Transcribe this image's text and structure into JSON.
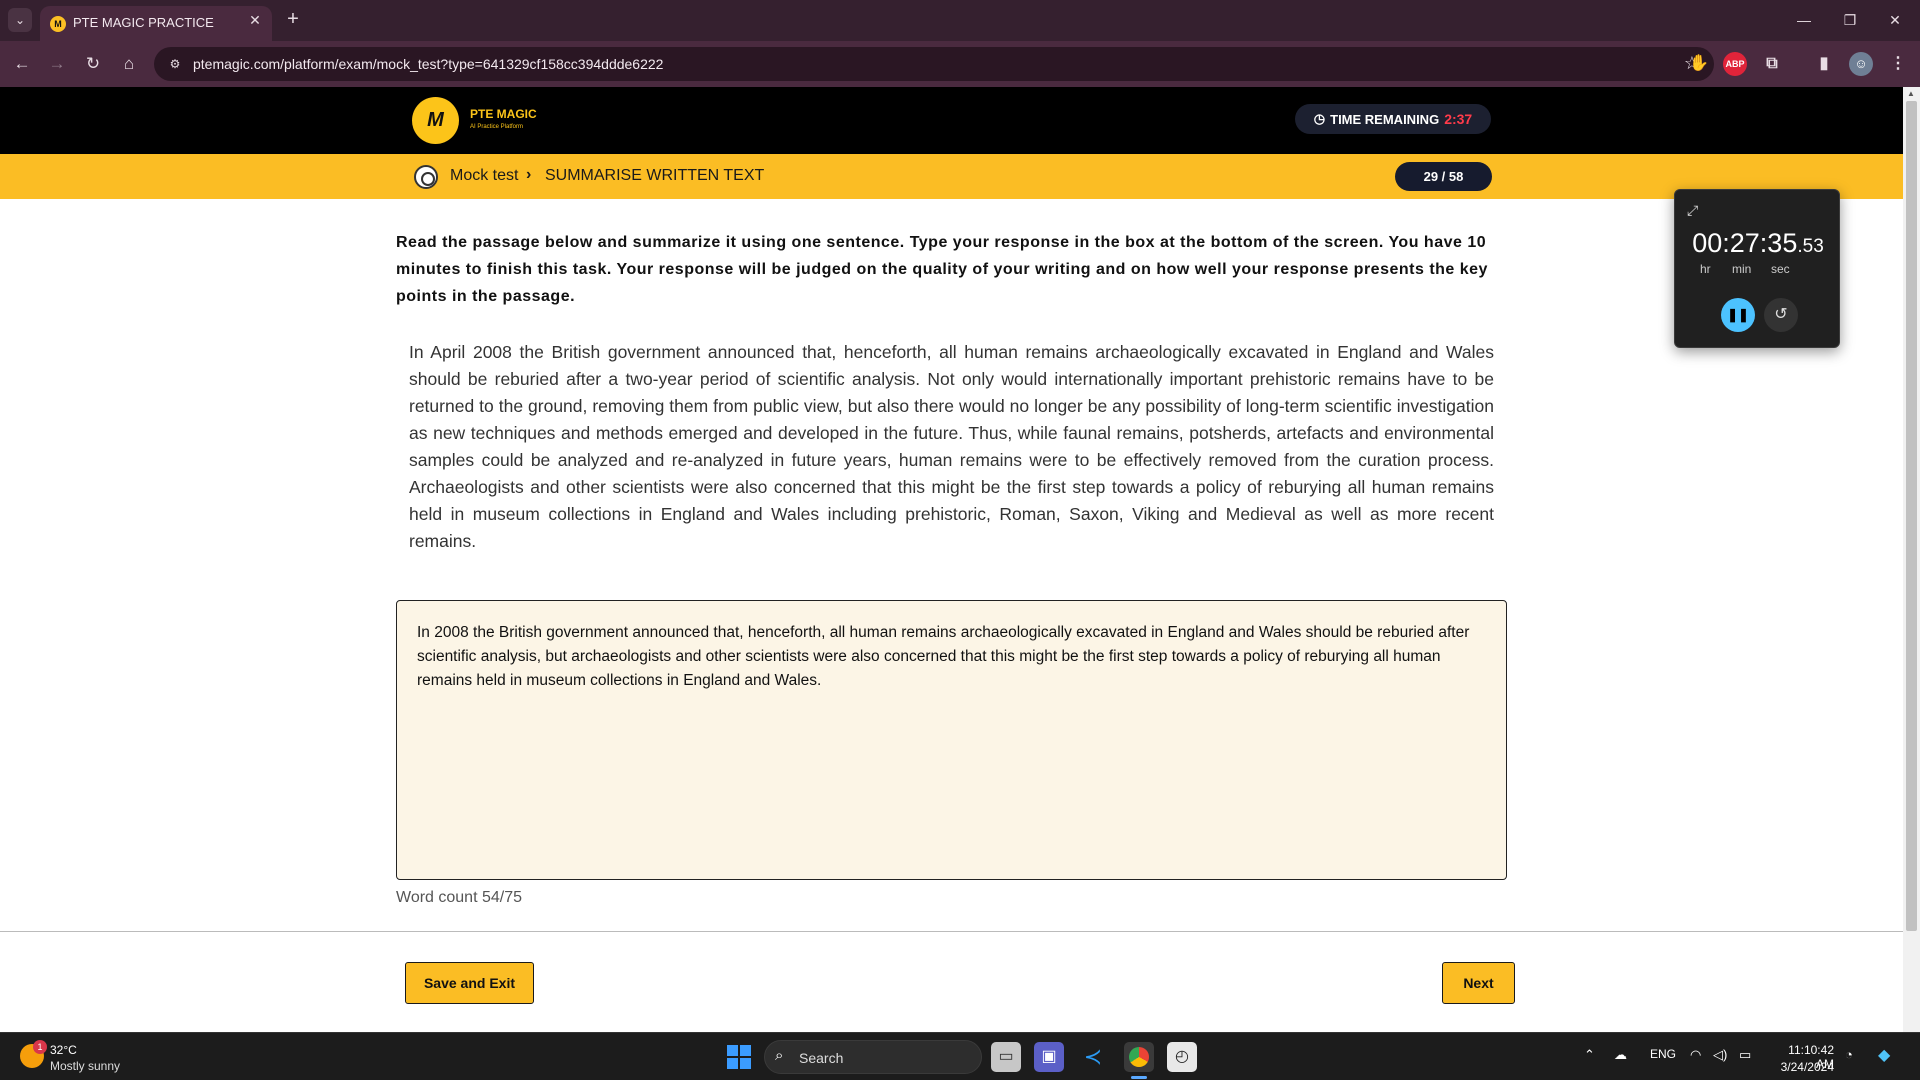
{
  "browser": {
    "tab_title": "PTE MAGIC PRACTICE",
    "tab_favicon": "M",
    "tab_close": "✕",
    "new_tab": "+",
    "url": "ptemagic.com/platform/exam/mock_test?type=641329cf158cc394ddde6222",
    "extensions": {
      "abp": "ABP"
    }
  },
  "header": {
    "logo_text": "PTE MAGIC",
    "logo_sub": "AI Practice Platform",
    "logo_mark": "M",
    "timer_label": "TIME REMAINING",
    "timer_value": "2:37"
  },
  "breadcrumb": {
    "root": "Mock test",
    "separator": "›",
    "current": "SUMMARISE WRITTEN TEXT",
    "progress": "29 / 58"
  },
  "main": {
    "instructions": "Read the passage below and summarize it using one sentence. Type your response in the box at the bottom of the screen. You have 10 minutes to finish this task. Your response will be judged on the quality of your writing and on how well your response presents the key points in the passage.",
    "passage": "In April 2008 the British government announced that, henceforth, all human remains archaeologically excavated in England and Wales should be reburied after a two-year period of scientific analysis. Not only would internationally important prehistoric remains have to be returned to the ground, removing them from public view, but also there would no longer be any possibility of long-term scientific investigation as new techniques and methods emerged and developed in the future. Thus, while faunal remains, potsherds, artefacts and environmental samples could be analyzed and re-analyzed in future years, human remains were to be effectively removed from the curation process. Archaeologists and other scientists were also concerned that this might be the first step towards a policy of reburying all human remains held in museum collections in England and Wales including prehistoric, Roman, Saxon, Viking and Medieval as well as more recent remains.",
    "response": "In 2008 the British government announced that, henceforth, all human remains archaeologically excavated in England and Wales should be reburied after scientific analysis, but archaeologists and other scientists were also concerned that this might be the first step towards a policy of reburying all human remains held in museum collections in England and Wales.",
    "word_count": "Word count 54/75"
  },
  "footer": {
    "save_exit_label": "Save and Exit",
    "next_label": "Next"
  },
  "stopwatch": {
    "time": "00:27:35",
    "ms": ".53",
    "unit_hr": "hr",
    "unit_min": "min",
    "unit_sec": "sec"
  },
  "taskbar": {
    "weather_temp": "32°C",
    "weather_desc": "Mostly sunny",
    "weather_badge": "1",
    "search_placeholder": "Search",
    "language": "ENG",
    "clock_time": "11:10:42 AM",
    "clock_date": "3/24/2024"
  },
  "colors": {
    "accent_yellow": "#fbbd24",
    "header_black": "#000000",
    "timer_red": "#ff3b4a",
    "response_bg": "#fcf5e6"
  }
}
